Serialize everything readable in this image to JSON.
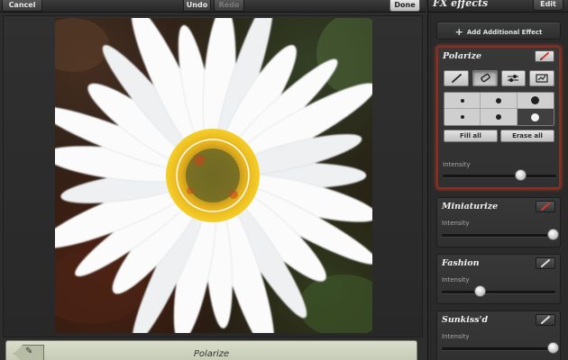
{
  "toolbar": {
    "cancel_label": "Cancel",
    "undo_label": "Undo",
    "redo_label": "Redo",
    "done_label": "Done"
  },
  "canvas": {
    "bottom_label": "Polarize"
  },
  "panel": {
    "title": "FX effects",
    "edit_label": "Edit",
    "add_label": "Add Additional Effect"
  },
  "effects": [
    {
      "name": "Polarize",
      "intensity_label": "Intensity",
      "intensity": 0.68,
      "active": true
    },
    {
      "name": "Miniaturize",
      "intensity_label": "Intensity",
      "intensity": 0.98,
      "active": false
    },
    {
      "name": "Fashion",
      "intensity_label": "Intensity",
      "intensity": 0.33,
      "active": false
    },
    {
      "name": "Sunkiss'd",
      "intensity_label": "Intensity",
      "intensity": 0.98,
      "active": false
    }
  ],
  "polarize_tools": {
    "tabs": [
      "brush-icon",
      "eraser-icon",
      "settings-sliders-icon",
      "invert-selection-icon"
    ],
    "selected_tab": 1,
    "brush_sizes": [
      "small",
      "medium",
      "large",
      "small",
      "medium",
      "large"
    ],
    "selected_brush": 5,
    "fill_all_label": "Fill all",
    "erase_all_label": "Erase all"
  },
  "colors": {
    "active_effect_border": "#c2412b",
    "panel_bg": "#2a2a2a",
    "red_accent": "#d33a2c"
  }
}
